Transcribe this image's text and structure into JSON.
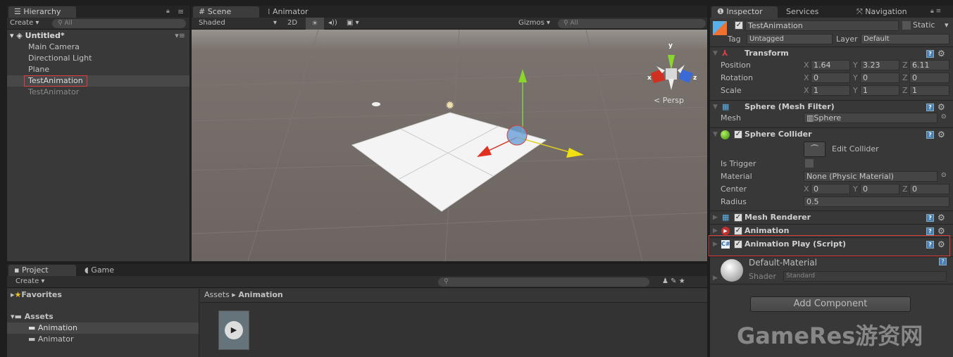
{
  "hierarchy": {
    "tab": "Hierarchy",
    "create": "Create",
    "search_placeholder": "All",
    "scene": "Untitled*",
    "items": [
      "Main Camera",
      "Directional Light",
      "Plane",
      "TestAnimation",
      "TestAnimator"
    ],
    "selected": "TestAnimation"
  },
  "scene": {
    "tabs": [
      "Scene",
      "Animator"
    ],
    "shading": "Shaded",
    "mode_2d": "2D",
    "gizmos": "Gizmos",
    "search_placeholder": "All",
    "projection": "Persp",
    "axis_labels": {
      "x": "x",
      "y": "y",
      "z": "z"
    }
  },
  "project": {
    "tabs": [
      "Project",
      "Game"
    ],
    "create": "Create",
    "favorites": "Favorites",
    "assets": "Assets",
    "folders": [
      "Animation",
      "Animator"
    ],
    "breadcrumb": [
      "Assets",
      "Animation"
    ]
  },
  "inspector": {
    "tabs": [
      "Inspector",
      "Services",
      "Navigation"
    ],
    "object_name": "TestAnimation",
    "static": "Static",
    "tag_label": "Tag",
    "tag": "Untagged",
    "layer_label": "Layer",
    "layer": "Default",
    "transform": {
      "title": "Transform",
      "rows": [
        {
          "label": "Position",
          "x": "1.64",
          "y": "3.23",
          "z": "6.11"
        },
        {
          "label": "Rotation",
          "x": "0",
          "y": "0",
          "z": "0"
        },
        {
          "label": "Scale",
          "x": "1",
          "y": "1",
          "z": "1"
        }
      ]
    },
    "mesh_filter": {
      "title": "Sphere (Mesh Filter)",
      "mesh_label": "Mesh",
      "mesh": "Sphere"
    },
    "collider": {
      "title": "Sphere Collider",
      "edit": "Edit Collider",
      "is_trigger": "Is Trigger",
      "material_label": "Material",
      "material": "None (Physic Material)",
      "center_label": "Center",
      "cx": "0",
      "cy": "0",
      "cz": "0",
      "radius_label": "Radius",
      "radius": "0.5"
    },
    "mesh_renderer": "Mesh Renderer",
    "animation": "Animation",
    "script": "Animation Play (Script)",
    "material": {
      "name": "Default-Material",
      "shader_label": "Shader",
      "shader": "Standard"
    },
    "add_component": "Add Component"
  },
  "axis_letters": {
    "x": "X",
    "y": "Y",
    "z": "Z"
  },
  "watermark": "GameRes游资网",
  "colors": {
    "highlight": "#e04040",
    "selection": "#4a4a4a"
  }
}
